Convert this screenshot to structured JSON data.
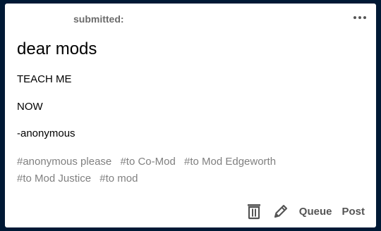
{
  "post": {
    "header": {
      "submitted_label": "submitted:",
      "more_icon": "ellipsis-icon"
    },
    "title": "dear mods",
    "body_lines": [
      "TEACH ME",
      "NOW",
      "-anonymous"
    ],
    "tags": [
      "#anonymous please",
      "#to Co-Mod",
      "#to Mod Edgeworth",
      "#to Mod Justice",
      "#to mod"
    ],
    "footer": {
      "delete_icon": "trash-icon",
      "edit_icon": "pencil-icon",
      "queue_label": "Queue",
      "post_label": "Post"
    }
  },
  "colors": {
    "page_background": "#001935",
    "card_background": "#ffffff",
    "tag_text": "#808080",
    "header_text": "#6b6b6b"
  }
}
